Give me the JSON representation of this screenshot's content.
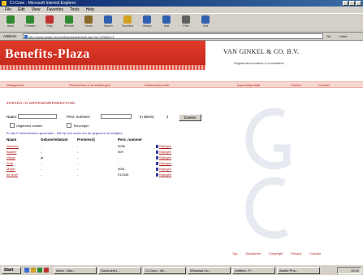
{
  "window": {
    "title": "Ci-Conn - Microsoft Internet Explorer"
  },
  "menu": [
    "File",
    "Edit",
    "View",
    "Favorites",
    "Tools",
    "Help"
  ],
  "toolbar": [
    {
      "label": "Back",
      "icon": "back-arrow-icon",
      "color": "#2f8a2f"
    },
    {
      "label": "Forward",
      "icon": "forward-arrow-icon",
      "color": "#2f8a2f"
    },
    {
      "label": "Stop",
      "icon": "stop-icon",
      "color": "#c03030"
    },
    {
      "label": "Refresh",
      "icon": "refresh-icon",
      "color": "#2f8a2f"
    },
    {
      "label": "Home",
      "icon": "home-icon",
      "color": "#8a6a2a"
    },
    {
      "label": "Search",
      "icon": "search-icon",
      "color": "#3060b0"
    },
    {
      "label": "Favorites",
      "icon": "favorites-icon",
      "color": "#d0a020"
    },
    {
      "label": "History",
      "icon": "history-icon",
      "color": "#3060b0"
    },
    {
      "label": "Mail",
      "icon": "mail-icon",
      "color": "#3060b0"
    },
    {
      "label": "Print",
      "icon": "print-icon",
      "color": "#606060"
    },
    {
      "label": "Edit",
      "icon": "edit-icon",
      "color": "#3060b0"
    }
  ],
  "address": {
    "label": "Address",
    "value": "http://www.ginkel.nl/benefitsplaza/default.asp?id=1234&b=1",
    "go_label": "Go",
    "links_label": "Links"
  },
  "site": {
    "logo": "Benefits-Plaza",
    "company": "VAN GINKEL & CO. B.V.",
    "tagline": "Registeraccountants & consultants"
  },
  "nav": [
    "Werkgevers",
    "Pensioenen & verzekeringen",
    "Werknemers-info",
    "Inspectieportaal",
    "Zoeken",
    "Contact"
  ],
  "form": {
    "section_title": "ZOEKEN IN WERKNEMERSBESTAND",
    "name_label": "Naam:",
    "number_label": "Pers. nummer:",
    "active_label": "In dienst:",
    "active_value": "J",
    "search_button": "Zoeken",
    "option1": "Uitgebreid zoeken",
    "option2": "Toevoegen"
  },
  "results": {
    "note": "Er zijn 6 medewerkers gevonden - klik op een naam om de gegevens te bekijken",
    "headers": [
      "Naam",
      "Geboortedatum",
      "Premievrij",
      "Pers. nummer"
    ],
    "rows": [
      {
        "name": "Janssen",
        "birth": "-",
        "premievrij": "-",
        "number": "0096",
        "action": "Wijzigen"
      },
      {
        "name": "Bakker",
        "birth": "-",
        "premievrij": "-",
        "number": "009",
        "action": "Wijzigen"
      },
      {
        "name": "Visser",
        "birth": "ja",
        "premievrij": "-",
        "number": "-",
        "action": "Wijzigen"
      },
      {
        "name": "Smit",
        "birth": "-",
        "premievrij": "-",
        "number": "-",
        "action": "Wijzigen"
      },
      {
        "name": "Meijer",
        "birth": "-",
        "premievrij": "-",
        "number": "0061",
        "action": "Wijzigen"
      },
      {
        "name": "de Boer",
        "birth": "-",
        "premievrij": "-",
        "number": "012345",
        "action": "Wijzigen"
      }
    ]
  },
  "footer": [
    "Top",
    "Disclaimer",
    "Copyright",
    "Privacy",
    "Colofon"
  ],
  "taskbar": {
    "start": "Start",
    "tasks": [
      "Inbox - Micr...",
      "Document1...",
      "Ci-Conn - Mi...",
      "Windows Co...",
      "Untitled - P...",
      "Adobe Pho..."
    ],
    "clock": "10:42"
  },
  "colors": {
    "banner": "#d8342a",
    "link": "#b02020",
    "chrome": "#d4d0c8"
  }
}
